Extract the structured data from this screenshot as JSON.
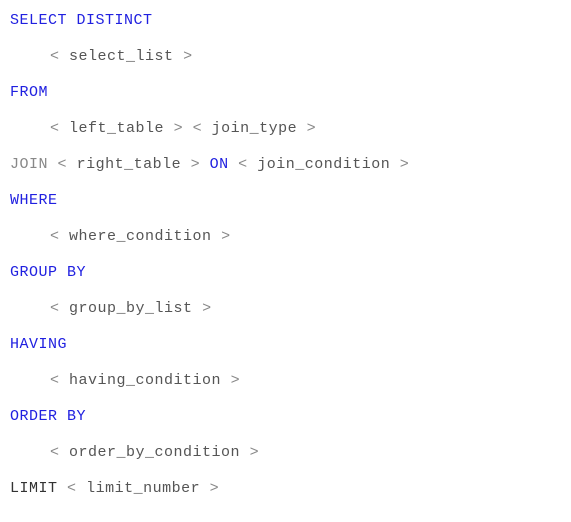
{
  "sql": {
    "keywords": {
      "select": "SELECT",
      "distinct": "DISTINCT",
      "from": "FROM",
      "join": "JOIN",
      "on": "ON",
      "where": "WHERE",
      "group_by": "GROUP BY",
      "having": "HAVING",
      "order_by": "ORDER BY",
      "limit": "LIMIT"
    },
    "placeholders": {
      "select_list": "select_list",
      "left_table": "left_table",
      "join_type": "join_type",
      "right_table": "right_table",
      "join_condition": "join_condition",
      "where_condition": "where_condition",
      "group_by_list": "group_by_list",
      "having_condition": "having_condition",
      "order_by_condition": "order_by_condition",
      "limit_number": "limit_number"
    },
    "operators": {
      "lt": "<",
      "gt": ">"
    }
  }
}
